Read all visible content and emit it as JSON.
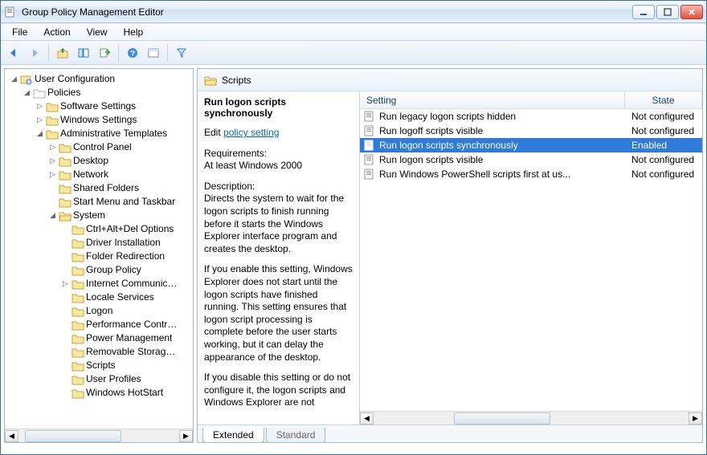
{
  "window": {
    "title": "Group Policy Management Editor"
  },
  "menu": {
    "file": "File",
    "action": "Action",
    "view": "View",
    "help": "Help"
  },
  "tree": {
    "root": "User Configuration",
    "policies": "Policies",
    "software": "Software Settings",
    "windows": "Windows Settings",
    "admin": "Administrative Templates",
    "controlpanel": "Control Panel",
    "desktop": "Desktop",
    "network": "Network",
    "shared": "Shared Folders",
    "startmenu": "Start Menu and Taskbar",
    "system": "System",
    "ctrlaltdel": "Ctrl+Alt+Del Options",
    "driver": "Driver Installation",
    "folderredir": "Folder Redirection",
    "grouppolicy": "Group Policy",
    "internetcomm": "Internet Communication Management",
    "locale": "Locale Services",
    "logon": "Logon",
    "perf": "Performance Control Panel",
    "power": "Power Management",
    "removable": "Removable Storage Access",
    "scripts": "Scripts",
    "userprofiles": "User Profiles",
    "hotstart": "Windows HotStart"
  },
  "header": {
    "title": "Scripts"
  },
  "desc": {
    "heading": "Run logon scripts synchronously",
    "edit_prefix": "Edit ",
    "edit_link": "policy setting",
    "req_label": "Requirements:",
    "req_value": "At least Windows 2000",
    "desc_label": "Description:",
    "para1": "Directs the system to wait for the logon scripts to finish running before it starts the Windows Explorer interface program and creates the desktop.",
    "para2": "If you enable this setting, Windows Explorer does not start until the logon scripts have finished running. This setting ensures that logon script processing is complete before the user starts working, but it can delay the appearance of the desktop.",
    "para3": "If you disable this setting or do not configure it, the logon scripts and Windows Explorer are not"
  },
  "list": {
    "col_setting": "Setting",
    "col_state": "State",
    "rows": [
      {
        "name": "Run legacy logon scripts hidden",
        "state": "Not configured",
        "selected": false
      },
      {
        "name": "Run logoff scripts visible",
        "state": "Not configured",
        "selected": false
      },
      {
        "name": "Run logon scripts synchronously",
        "state": "Enabled",
        "selected": true
      },
      {
        "name": "Run logon scripts visible",
        "state": "Not configured",
        "selected": false
      },
      {
        "name": "Run Windows PowerShell scripts first at us...",
        "state": "Not configured",
        "selected": false
      }
    ]
  },
  "tabs": {
    "extended": "Extended",
    "standard": "Standard"
  }
}
